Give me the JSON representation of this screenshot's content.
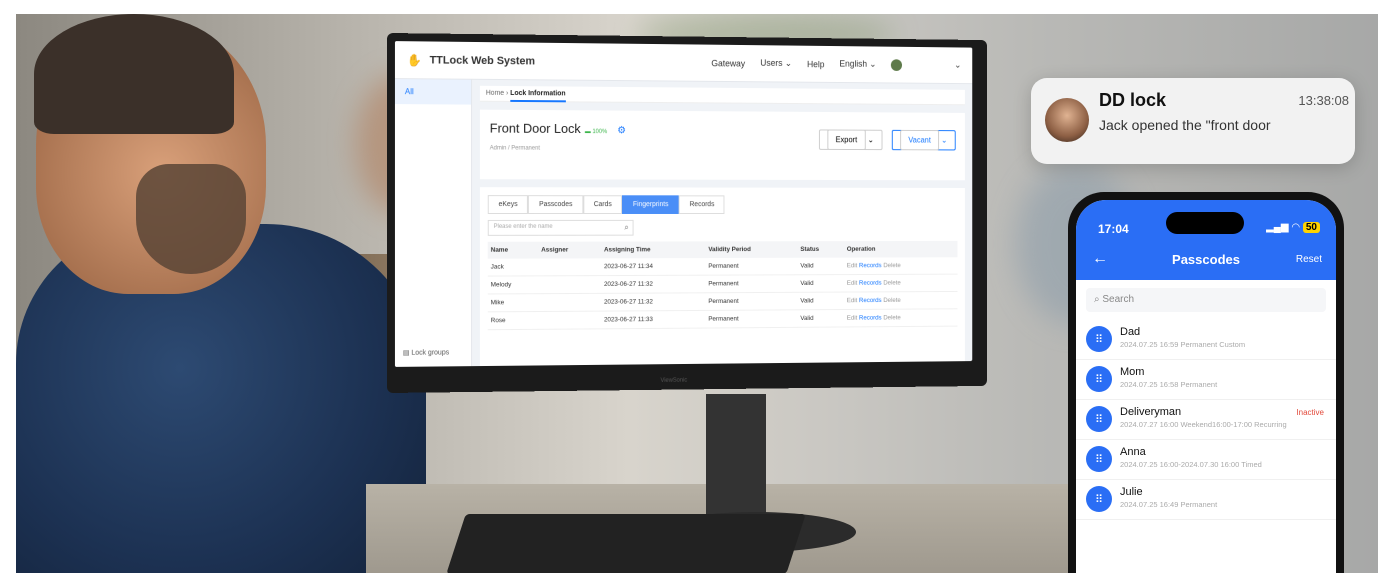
{
  "web": {
    "brand": "TTLock Web System",
    "nav": [
      "Gateway",
      "Users",
      "Help",
      "English"
    ],
    "sidebar_item": "All",
    "lock_groups": "Lock groups",
    "breadcrumb_home": "Home",
    "breadcrumb_current": "Lock Information",
    "lock_name": "Front Door Lock",
    "battery": "100%",
    "lock_sub": "Admin / Permanent",
    "export_label": "Export",
    "vacant_label": "Vacant",
    "tabs": [
      "eKeys",
      "Passcodes",
      "Cards",
      "Fingerprints",
      "Records"
    ],
    "search_placeholder": "Please enter the name",
    "columns": [
      "Name",
      "Assigner",
      "Assigning Time",
      "Validity Period",
      "Status",
      "Operation"
    ],
    "rows": [
      {
        "name": "Jack",
        "time": "2023-06-27 11:34",
        "validity": "Permanent",
        "status": "Valid"
      },
      {
        "name": "Melody",
        "time": "2023-06-27 11:32",
        "validity": "Permanent",
        "status": "Valid"
      },
      {
        "name": "Mike",
        "time": "2023-06-27 11:32",
        "validity": "Permanent",
        "status": "Valid"
      },
      {
        "name": "Rose",
        "time": "2023-06-27 11:33",
        "validity": "Permanent",
        "status": "Valid"
      }
    ],
    "op_edit": "Edit",
    "op_records": "Records",
    "op_delete": "Delete",
    "monitor_brand": "ViewSonic"
  },
  "notification": {
    "title": "DD lock",
    "time": "13:38:08",
    "message": "Jack opened the \"front door"
  },
  "phone": {
    "clock": "17:04",
    "battery": "50",
    "title": "Passcodes",
    "reset": "Reset",
    "search": "Search",
    "items": [
      {
        "name": "Dad",
        "detail": "2024.07.25 16:59 Permanent Custom",
        "flag": ""
      },
      {
        "name": "Mom",
        "detail": "2024.07.25 16:58 Permanent",
        "flag": ""
      },
      {
        "name": "Deliveryman",
        "detail": "2024.07.27 16:00 Weekend16:00-17:00 Recurring",
        "flag": "Inactive"
      },
      {
        "name": "Anna",
        "detail": "2024.07.25 16:00-2024.07.30 16:00 Timed",
        "flag": ""
      },
      {
        "name": "Julie",
        "detail": "2024.07.25 16:49 Permanent",
        "flag": ""
      }
    ]
  },
  "colors": {
    "accent": "#2a6ef5",
    "web_accent": "#1677ff",
    "inactive": "#e24a3b"
  }
}
